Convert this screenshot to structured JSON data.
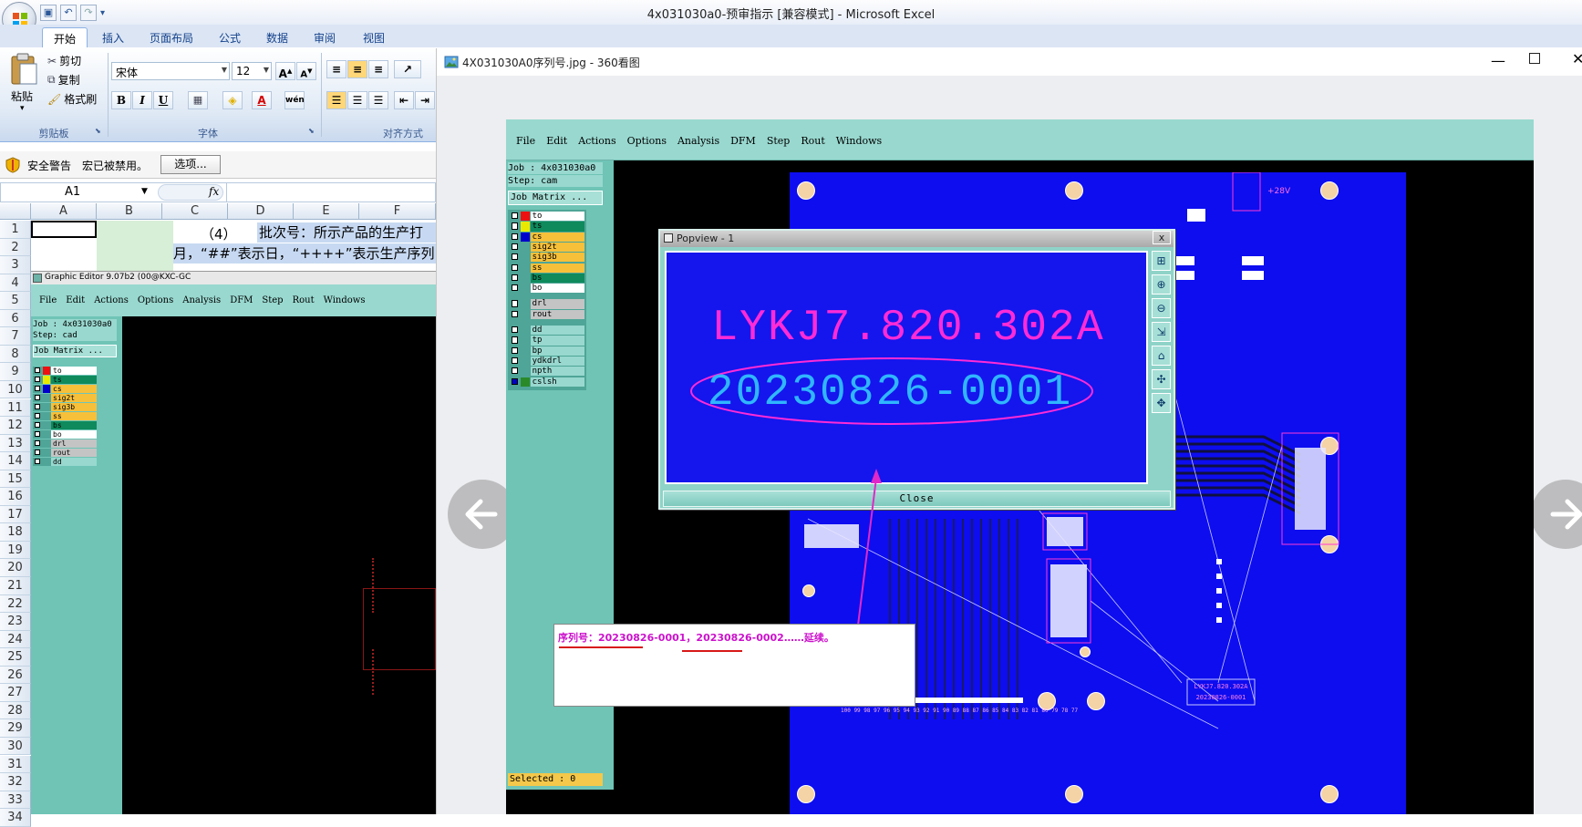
{
  "excel": {
    "title": "4x031030a0-预审指示  [兼容模式] - Microsoft Excel",
    "tabs": [
      "开始",
      "插入",
      "页面布局",
      "公式",
      "数据",
      "审阅",
      "视图"
    ],
    "clipboard": {
      "paste": "粘贴",
      "cut": "剪切",
      "copy": "复制",
      "format_painter": "格式刷",
      "group": "剪贴板"
    },
    "font": {
      "name": "宋体",
      "size": "12",
      "group": "字体",
      "bold": "B",
      "italic": "I",
      "underline": "U",
      "grow": "A",
      "shrink": "A"
    },
    "alignment": {
      "group": "对齐方式"
    },
    "security": {
      "label": "安全警告",
      "message": "宏已被禁用。",
      "options_button": "选项..."
    },
    "name_box": "A1",
    "fx": "fx",
    "columns": [
      "A",
      "B",
      "C",
      "D",
      "E",
      "F"
    ],
    "rows": [
      "1",
      "2",
      "3",
      "4",
      "5",
      "6",
      "7",
      "8",
      "9",
      "10",
      "11",
      "12",
      "13",
      "14",
      "15",
      "16",
      "17",
      "18",
      "19",
      "20",
      "21",
      "22",
      "23",
      "24",
      "25",
      "26",
      "27",
      "28",
      "29",
      "30",
      "31",
      "32",
      "33",
      "34"
    ],
    "cell_c2": "（4）",
    "cell_d2": "批次号：所示产品的生产打",
    "cell_row3": "月，“##”表示日，“++++”表示生产序列",
    "ge_small": {
      "title": "Graphic Editor 9.07b2 (00@KXC-GC",
      "menu": [
        "File",
        "Edit",
        "Actions",
        "Options",
        "Analysis",
        "DFM",
        "Step",
        "Rout",
        "Windows"
      ],
      "job": "Job : 4x031030a0",
      "step": "Step: cad",
      "matrix": "Job Matrix ...",
      "layers": [
        "to",
        "ts",
        "cs",
        "sig2t",
        "sig3b",
        "ss",
        "bs",
        "bo",
        "drl",
        "rout",
        "dd"
      ]
    }
  },
  "viewer": {
    "title": "4X031030A0序列号.jpg - 360看图",
    "cam": {
      "menu": [
        "File",
        "Edit",
        "Actions",
        "Options",
        "Analysis",
        "DFM",
        "Step",
        "Rout",
        "Windows"
      ],
      "job": "Job : 4x031030a0",
      "step": "Step: cam",
      "matrix": "Job Matrix ...",
      "layers_top": [
        "to",
        "ts",
        "cs",
        "sig2t",
        "sig3b",
        "ss",
        "bs",
        "bo"
      ],
      "layers_mid": [
        "drl",
        "rout"
      ],
      "layers_bot": [
        "dd",
        "tp",
        "bp",
        "ydkdrl",
        "npth",
        "cslsh"
      ],
      "selected": "Selected : 0",
      "popview_title": "Popview - 1",
      "popview_close_x": "x",
      "part_number": "LYKJ7.820.302A",
      "serial": "20230826-0001",
      "close_button": "Close",
      "note": "序列号：20230826-0001，20230826-0002……延续。",
      "board_label_1": "LYKJ7.820.302A",
      "board_label_2": "20230826-0001",
      "board_voltage": "+28V"
    }
  },
  "colors": {
    "pcb_blue": "#0d0df0",
    "magenta": "#ff2bd6",
    "cyan_text": "#2fb6ff",
    "cam_teal": "#98d8cf"
  }
}
